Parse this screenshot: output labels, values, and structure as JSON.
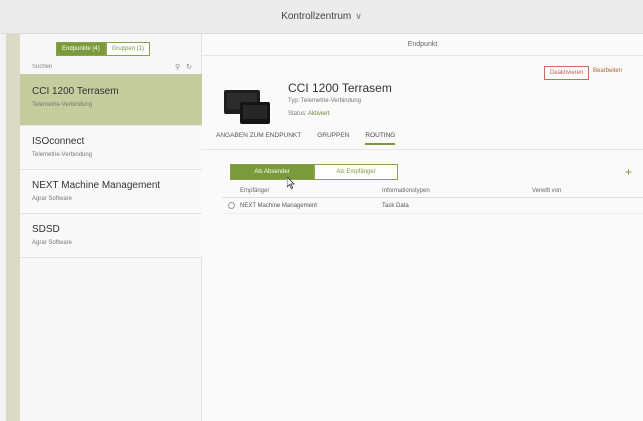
{
  "topbar": {
    "title": "Kontrollzentrum"
  },
  "sidebar": {
    "segments": {
      "endpoints": "Endpunkte (4)",
      "groups": "Gruppen (1)"
    },
    "search_placeholder": "Suchen",
    "items": [
      {
        "name": "CCI 1200 Terrasem",
        "sub": "Telemetrie-Verbindung"
      },
      {
        "name": "ISOconnect",
        "sub": "Telemetrie-Verbindung"
      },
      {
        "name": "NEXT Machine Management",
        "sub": "Agrar Software"
      },
      {
        "name": "SDSD",
        "sub": "Agrar Software"
      }
    ]
  },
  "main": {
    "header": "Endpunkt",
    "buttons": {
      "deactivate": "Deaktivieren",
      "edit": "Bearbeiten"
    },
    "device": {
      "title": "CCI 1200 Terrasem",
      "typ": "Typ: Telemetrie-Verbindung",
      "status_label": "Status:",
      "status_value": "Aktiviert"
    },
    "tabs": [
      "ANGABEN ZUM ENDPUNKT",
      "GRUPPEN",
      "ROUTING"
    ],
    "toggle": {
      "sender": "Als Absender",
      "receiver": "Als Empfänger"
    },
    "add": "+",
    "table": {
      "headers": [
        "Empfänger",
        "Informationstypen",
        "Verwltt von"
      ],
      "rows": [
        {
          "receiver": "NEXT Machine Management",
          "info": "Task Data",
          "by": ""
        }
      ]
    }
  },
  "colors": {
    "accent": "#7a9a3b",
    "selected": "#c5cc9d",
    "danger": "#c55a4a"
  }
}
